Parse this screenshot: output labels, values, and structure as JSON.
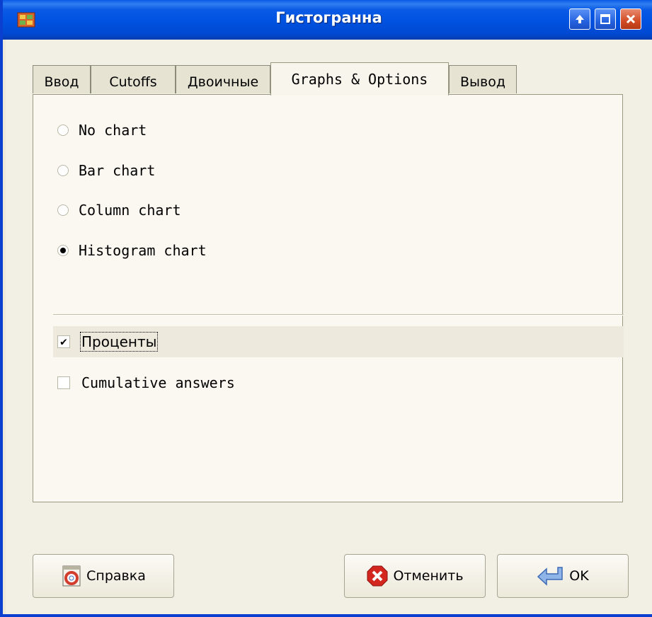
{
  "window": {
    "title": "Гистогранна"
  },
  "tabs": [
    {
      "label": "Ввод"
    },
    {
      "label": "Cutoffs"
    },
    {
      "label": "Двоичные"
    },
    {
      "label": "Graphs & Options",
      "active": true
    },
    {
      "label": "Вывод"
    }
  ],
  "chart_options": [
    {
      "label": "No chart",
      "selected": false
    },
    {
      "label": "Bar chart",
      "selected": false
    },
    {
      "label": "Column chart",
      "selected": false
    },
    {
      "label": "Histogram chart",
      "selected": true
    }
  ],
  "checkboxes": [
    {
      "label": "Проценты",
      "checked": true
    },
    {
      "label": "Cumulative answers",
      "checked": false
    }
  ],
  "buttons": {
    "help": "Справка",
    "cancel": "Отменить",
    "ok": "OK"
  },
  "colors": {
    "titlebar": "#0053e1",
    "panel": "#faf8f0"
  }
}
